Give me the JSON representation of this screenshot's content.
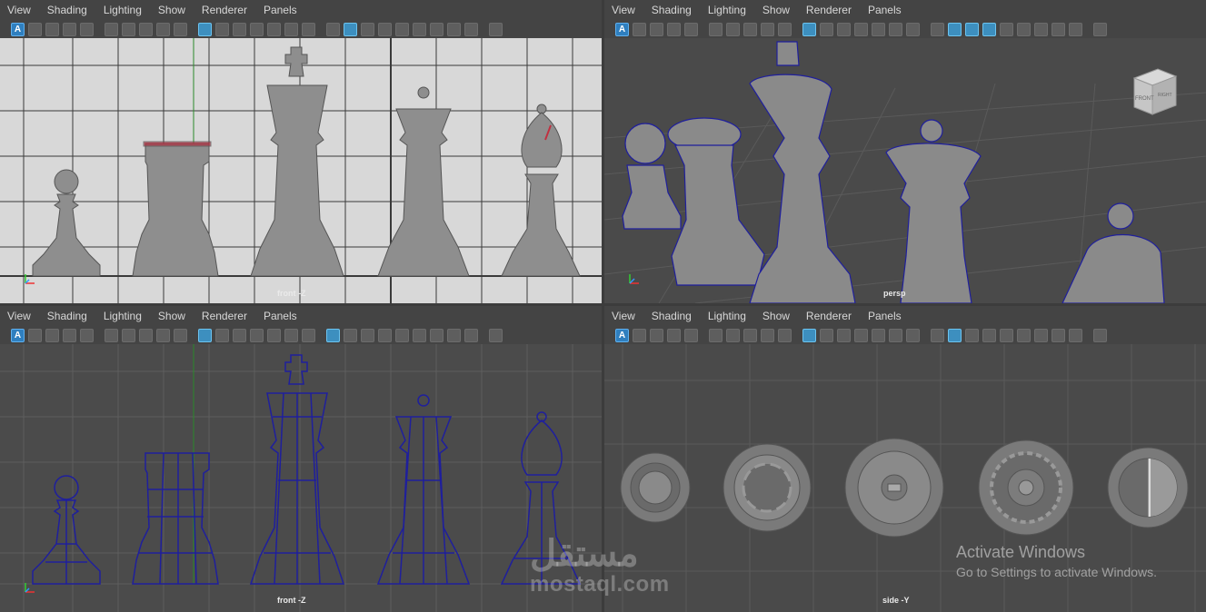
{
  "menus": [
    "View",
    "Shading",
    "Lighting",
    "Show",
    "Renderer",
    "Panels"
  ],
  "toolbar_icons": [
    "select-camera-icon",
    "camera-attributes-icon",
    "bookmark-icon",
    "image-plane-icon",
    "2d-pan-zoom-icon",
    "grease-pencil-icon",
    "grid-icon",
    "film-gate-icon",
    "resolution-gate-icon",
    "gate-mask-icon",
    "field-chart-icon",
    "safe-action-icon",
    "safe-title-icon",
    "wireframe-icon",
    "smooth-shade-icon",
    "wireframe-on-shaded-icon",
    "xray-icon",
    "lights-icon",
    "shadows-icon",
    "ambient-occlusion-icon",
    "motion-blur-icon",
    "isolate-select-icon"
  ],
  "viewports": {
    "top_left": {
      "label": "front -Z",
      "mode": "shaded"
    },
    "top_right": {
      "label": "persp",
      "mode": "wireframe-on-shaded"
    },
    "bottom_left": {
      "label": "front -Z",
      "mode": "wireframe"
    },
    "bottom_right": {
      "label": "side -Y",
      "mode": "shaded"
    }
  },
  "viewcube": {
    "front": "FRONT",
    "right": "RIGHT"
  },
  "watermark": {
    "logo": "مستقل",
    "site": "mostaql.com"
  },
  "activation": {
    "title": "Activate Windows",
    "subtitle": "Go to Settings to activate Windows."
  },
  "colors": {
    "background": "#444444",
    "grid": "#555555",
    "wire": "#1f1f9c",
    "piece": "#8c8c8c",
    "active_icon": "#2f7fbf"
  }
}
